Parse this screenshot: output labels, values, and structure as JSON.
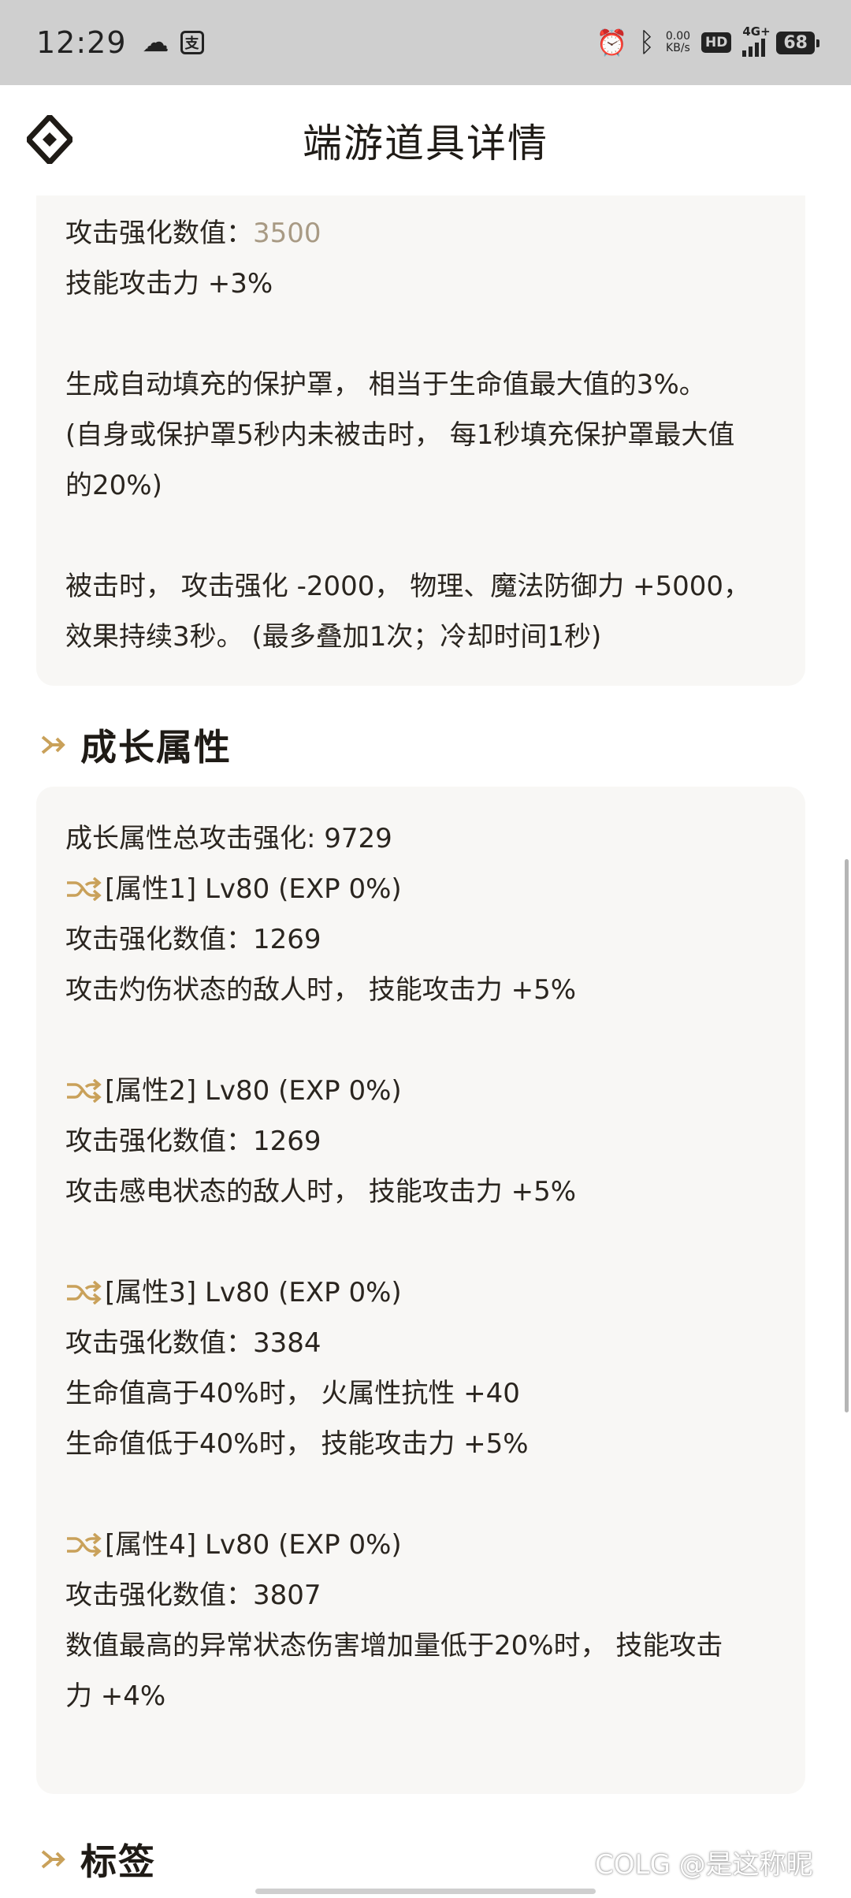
{
  "status_bar": {
    "time": "12:29",
    "app_icon_text": "支",
    "net_speed": "0.00",
    "net_unit": "KB/s",
    "hd": "HD",
    "network": "4G+",
    "battery": "68"
  },
  "header": {
    "title": "端游道具详情"
  },
  "effect_card": {
    "attack_label": "攻击强化数值：",
    "attack_value": "3500",
    "lines": [
      "技能攻击力 +3%",
      "生成自动填充的保护罩， 相当于生命值最大值的3%。",
      "(自身或保护罩5秒内未被击时， 每1秒填充保护罩最大值",
      "的20%)",
      "被击时， 攻击强化 -2000， 物理、魔法防御力 +5000，",
      "效果持续3秒。 (最多叠加1次；冷却时间1秒)"
    ]
  },
  "growth_section": {
    "title": "成长属性",
    "total": "成长属性总攻击强化: 9729",
    "attrs": [
      {
        "name": "[属性1] Lv80 (EXP 0%)",
        "lines": [
          "攻击强化数值：1269",
          "攻击灼伤状态的敌人时， 技能攻击力 +5%"
        ]
      },
      {
        "name": "[属性2] Lv80 (EXP 0%)",
        "lines": [
          "攻击强化数值：1269",
          "攻击感电状态的敌人时， 技能攻击力 +5%"
        ]
      },
      {
        "name": "[属性3] Lv80 (EXP 0%)",
        "lines": [
          "攻击强化数值：3384",
          "生命值高于40%时， 火属性抗性 +40",
          "生命值低于40%时， 技能攻击力 +5%"
        ]
      },
      {
        "name": "[属性4] Lv80 (EXP 0%)",
        "lines": [
          "攻击强化数值：3807",
          "数值最高的异常状态伤害增加量低于20%时， 技能攻击",
          "力 +4%"
        ]
      }
    ]
  },
  "tags_section": {
    "title": "标签"
  },
  "watermark": "COLG @是这称昵",
  "colors": {
    "accent": "#c9a15a",
    "card_bg": "#f8f7f5",
    "muted_value": "#a89a84"
  },
  "icons": [
    "logo-icon",
    "shuffle-icon",
    "section-arrow-icon",
    "alarm-icon",
    "bluetooth-icon",
    "cloud-icon"
  ]
}
